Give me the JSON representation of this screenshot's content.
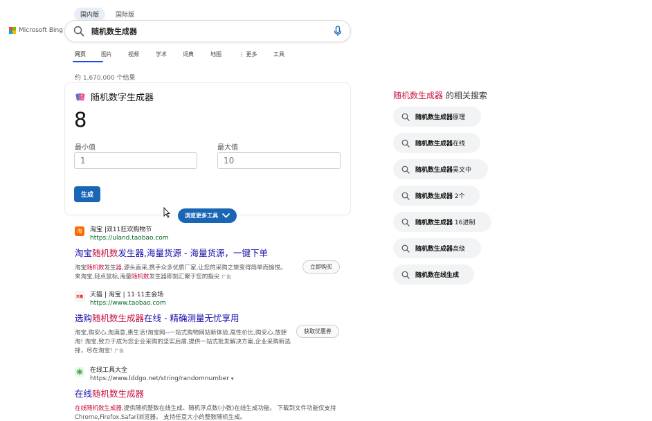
{
  "region_tabs": [
    "国内版",
    "国际版"
  ],
  "logo_text": "Microsoft Bing",
  "search": {
    "value": "随机数生成器"
  },
  "nav_tabs": [
    "网页",
    "图片",
    "视频",
    "学术",
    "词典",
    "地图",
    "⋮ 更多",
    "工具"
  ],
  "result_count": "约 1,670,000 个结果",
  "rng": {
    "title": "随机数字生成器",
    "result": "8",
    "min_label": "最小值",
    "max_label": "最大值",
    "min_value": "1",
    "max_value": "10",
    "generate_label": "生成",
    "more_tools_label": "浏览更多工具"
  },
  "results": [
    {
      "site": "淘宝 |双11狂欢购物节",
      "url": "https://uland.taobao.com",
      "title_pre": "淘宝",
      "title_hl": "随机数",
      "title_post": "发生器,海量货源 - 海量货源，一键下单",
      "desc_line1_pre": "淘宝",
      "desc_line1_hl1": "随机数",
      "desc_line1_mid": "发生",
      "desc_line1_hl2": "器",
      "desc_line1_post": ",源头直采,携手众多优质厂家,让您的采购之旅变得简单而愉悦。",
      "desc_line2_pre": "来淘宝,轻点鼠标,海量",
      "desc_line2_hl": "随机数",
      "desc_line2_post": "发生器即刻汇聚于您的指尖",
      "ad": "广告",
      "button": "立即购买"
    },
    {
      "site": "天猫 | 淘宝 | 11·11主会场",
      "url": "https://www.taobao.com",
      "title_pre": "选购",
      "title_hl": "随机数生成器",
      "title_post": "在线 - 精确测量无忧享用",
      "desc": "淘宝,购安心,淘满意,惠生活!淘宝网--一站式购物网站新体验,高性价比,购安心,放肆淘! 淘宝,致力于成为您企业采购的坚实后盾,提供一站式批发解决方案,企业采购新选择，尽在淘宝!",
      "ad": "广告",
      "button": "获取优惠券"
    },
    {
      "site": "在线工具大全",
      "url": "https://www.lddgo.net/string/randomnumber",
      "url_caret": "▾",
      "title_pre": "在线",
      "title_hl": "随机数生成器",
      "desc_hl": "在线随机数生成器",
      "desc_post": ",提供随机整数在线生成、随机浮点数(小数)在线生成功能。 下载到文件功能仅支持Chrome,Firefox,Safari浏览器。 支持任意大小的整数随机生成。"
    }
  ],
  "related": {
    "title_hl": "随机数生成器",
    "title_post": " 的相关搜索",
    "items": [
      {
        "bold": "随机数生成器",
        "rest": "原理"
      },
      {
        "bold": "随机数生成器",
        "rest": "在线"
      },
      {
        "bold": "随机数生成器",
        "rest": "吴文中"
      },
      {
        "bold": "随机数生成器",
        "rest": " 2个"
      },
      {
        "bold": "随机数生成器",
        "rest": " 16进制"
      },
      {
        "bold": "随机数生成器",
        "rest": "高级"
      },
      {
        "bold": "随机数在线生成",
        "rest": ""
      }
    ]
  },
  "favicons": {
    "taobao": "淘",
    "tmall": "天猫"
  },
  "colors": {
    "accent": "#1a66b5",
    "highlight": "#c5113e",
    "link": "#1a0dab",
    "url": "#006621"
  }
}
